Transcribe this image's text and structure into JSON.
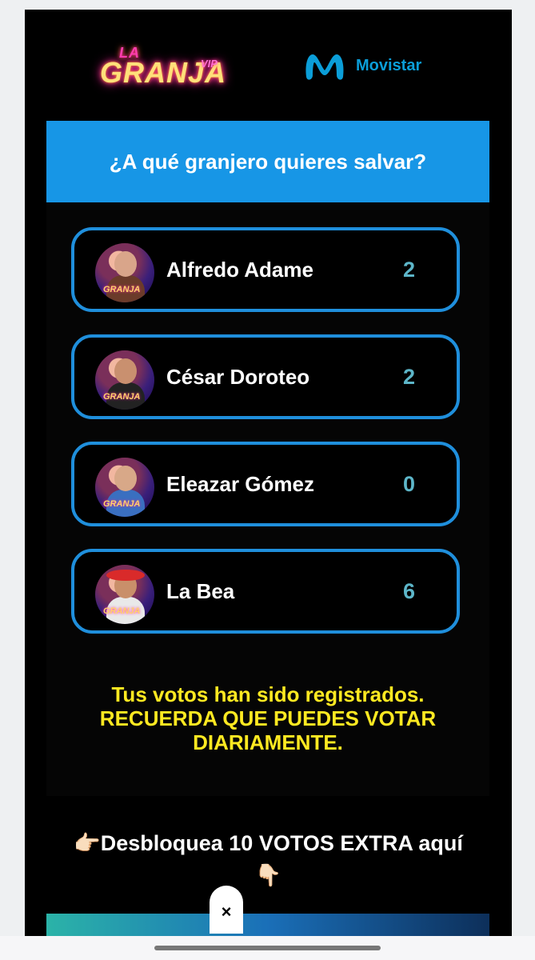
{
  "header": {
    "granja_logo": {
      "la": "LA",
      "granja": "GRANJA",
      "vip": "VIP"
    },
    "sponsor": "Movistar"
  },
  "banner": {
    "question": "¿A qué granjero quieres salvar?"
  },
  "candidates": [
    {
      "name": "Alfredo Adame",
      "votes": "2",
      "avatar_tag": "GRANJA"
    },
    {
      "name": "César Doroteo",
      "votes": "2",
      "avatar_tag": "GRANJA"
    },
    {
      "name": "Eleazar Gómez",
      "votes": "0",
      "avatar_tag": "GRANJA"
    },
    {
      "name": "La Bea",
      "votes": "6",
      "avatar_tag": "GRANJA"
    }
  ],
  "notice": {
    "line1": "Tus votos han sido registrados.",
    "line2": "RECUERDA QUE PUEDES VOTAR",
    "line3": "DIARIAMENTE."
  },
  "extra_votes": {
    "prefix_emoji": "👉🏻",
    "text": "Desbloquea 10 VOTOS EXTRA aquí",
    "suffix_emoji": "👇🏻"
  },
  "ad": {
    "close_label": "×"
  },
  "colors": {
    "banner": "#1796e6",
    "card_border": "#1f8fdc",
    "votes": "#5db6c9",
    "notice": "#ffe921",
    "movistar": "#0b9ed8"
  }
}
